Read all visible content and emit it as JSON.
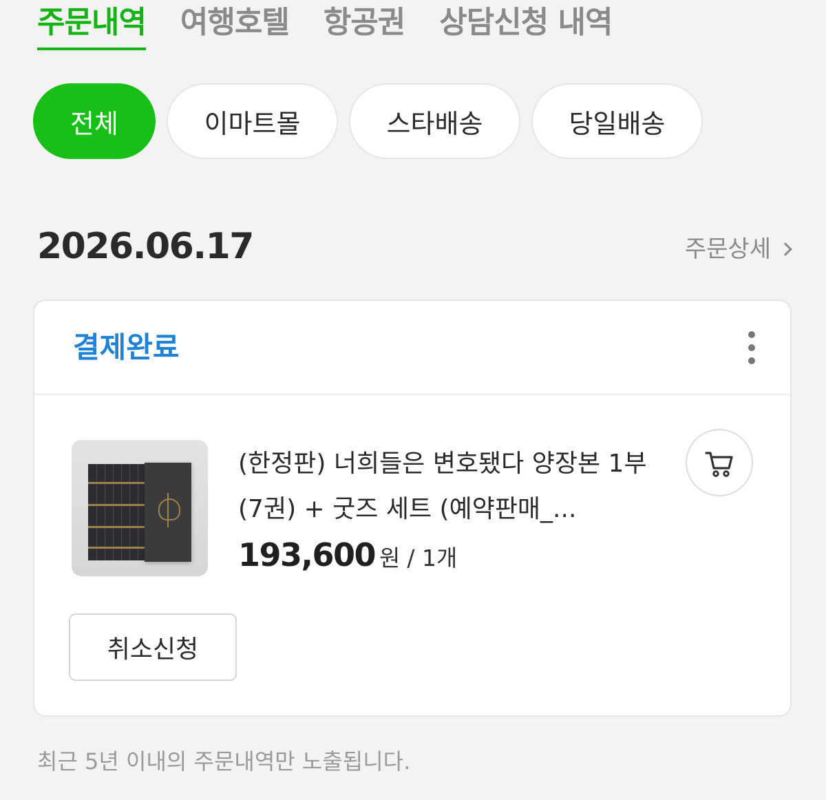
{
  "top_tabs": [
    {
      "label": "주문내역",
      "active": true
    },
    {
      "label": "여행호텔",
      "active": false
    },
    {
      "label": "항공권",
      "active": false
    },
    {
      "label": "상담신청 내역",
      "active": false
    }
  ],
  "filters": [
    {
      "label": "전체",
      "active": true
    },
    {
      "label": "이마트몰",
      "active": false
    },
    {
      "label": "스타배송",
      "active": false
    },
    {
      "label": "당일배송",
      "active": false
    }
  ],
  "order": {
    "date": "2026.06.17",
    "detail_link": "주문상세",
    "status": "결제완료",
    "item": {
      "name": "(한정판) 너희들은 변호됐다 양장본 1부 (7권) + 굿즈 세트 (예약판매_...",
      "price": "193,600",
      "currency": "원",
      "quantity": "/ 1개"
    },
    "cancel_label": "취소신청"
  },
  "notice": "최근 5년 이내의 주문내역만 노출됩니다.",
  "colors": {
    "accent_green": "#17bf17",
    "status_blue": "#1f82d6"
  },
  "icons": {
    "more": "more-vertical-icon",
    "cart": "cart-icon",
    "chevron": "chevron-right-icon"
  }
}
